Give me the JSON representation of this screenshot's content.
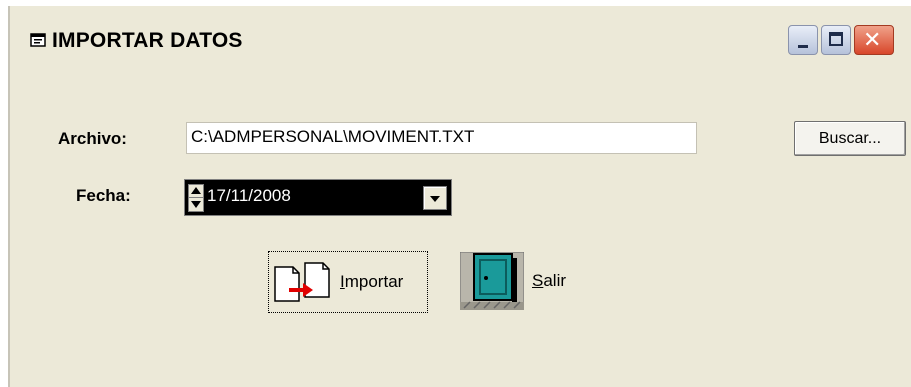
{
  "window": {
    "title": "IMPORTAR DATOS",
    "controls": {
      "minimize": "minimize",
      "maximize": "maximize",
      "close": "close"
    }
  },
  "form": {
    "archivo_label": "Archivo:",
    "archivo_value": "C:\\ADMPERSONAL\\MOVIMENT.TXT",
    "buscar_label": "Buscar...",
    "fecha_label": "Fecha:",
    "fecha_value": "17/11/2008"
  },
  "actions": {
    "importar": {
      "mnemonic": "I",
      "rest": "mportar"
    },
    "salir": {
      "mnemonic": "S",
      "rest": "alir"
    }
  },
  "icons": {
    "title": "window-app-icon",
    "importar": "import-files-icon",
    "salir": "exit-door-icon"
  },
  "colors": {
    "window_bg": "#ece9d8",
    "close_button": "#d8462a",
    "date_field_bg": "#000000",
    "import_arrow": "#e00000",
    "door": "#1a9a9a"
  }
}
